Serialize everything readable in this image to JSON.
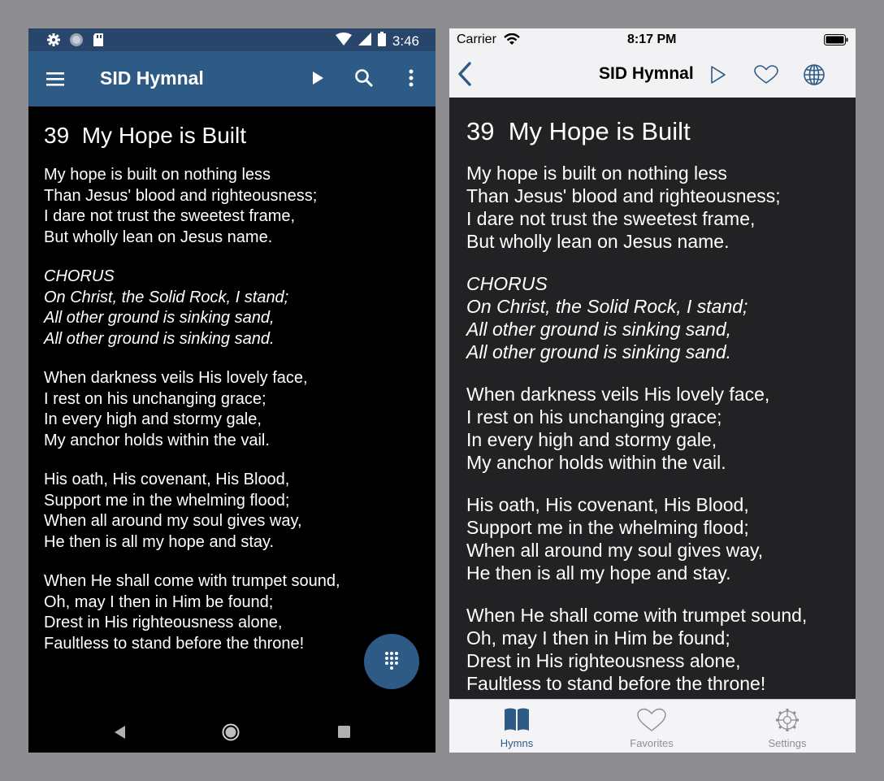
{
  "android": {
    "status": {
      "time": "3:46"
    },
    "app_title": "SID Hymnal",
    "hymn": {
      "number": "39",
      "title": "My Hope is Built",
      "stanzas": [
        {
          "italic": false,
          "lines": [
            "My hope is built on nothing less",
            "Than Jesus' blood and righteousness;",
            "I dare not trust the sweetest frame,",
            "But wholly lean on Jesus name."
          ]
        },
        {
          "italic": true,
          "lines": [
            "CHORUS",
            "On Christ, the Solid Rock, I stand;",
            "All other ground is sinking sand,",
            "All other ground is sinking sand."
          ]
        },
        {
          "italic": false,
          "lines": [
            "When darkness veils His lovely face,",
            "I rest on his unchanging grace;",
            "In every high and stormy gale,",
            "My anchor holds within the vail."
          ]
        },
        {
          "italic": false,
          "lines": [
            "His oath, His covenant, His Blood,",
            "Support me in the whelming flood;",
            "When all around my soul gives way,",
            "He then is all my hope and stay."
          ]
        },
        {
          "italic": false,
          "lines": [
            "When He shall come with trumpet sound,",
            "Oh, may I then in Him be found;",
            "Drest in His righteousness alone,",
            "Faultless to stand before the throne!"
          ]
        }
      ]
    },
    "colors": {
      "appbar": "#2e5a86",
      "statusbar": "#28456b",
      "background": "#000000"
    }
  },
  "ios": {
    "status": {
      "carrier": "Carrier",
      "time": "8:17 PM"
    },
    "nav_title": "SID Hymnal",
    "hymn": {
      "number": "39",
      "title": "My Hope is Built",
      "stanzas": [
        {
          "italic": false,
          "lines": [
            "My hope is built on nothing less",
            "Than Jesus' blood and righteousness;",
            "I dare not trust the sweetest frame,",
            "But wholly lean on Jesus name."
          ]
        },
        {
          "italic": true,
          "lines": [
            "CHORUS",
            "On Christ, the Solid Rock, I stand;",
            "All other ground is sinking sand,",
            "All other ground is sinking sand."
          ]
        },
        {
          "italic": false,
          "lines": [
            "When darkness veils His lovely face,",
            "I rest on his unchanging grace;",
            "In every high and stormy gale,",
            "My anchor holds within the vail."
          ]
        },
        {
          "italic": false,
          "lines": [
            "His oath, His covenant, His Blood,",
            "Support me in the whelming flood;",
            "When all around my soul gives way,",
            "He then is all my hope and stay."
          ]
        },
        {
          "italic": false,
          "lines": [
            "When He shall come with trumpet sound,",
            "Oh, may I then in Him be found;",
            "Drest in His righteousness alone,",
            "Faultless to stand before the throne!"
          ]
        }
      ]
    },
    "tabs": [
      {
        "label": "Hymns",
        "icon": "book-icon",
        "active": true
      },
      {
        "label": "Favorites",
        "icon": "heart-icon",
        "active": false
      },
      {
        "label": "Settings",
        "icon": "gear-icon",
        "active": false
      }
    ],
    "colors": {
      "accent": "#2e5a86",
      "background": "#222224",
      "bars": "#f2f2f4"
    }
  }
}
